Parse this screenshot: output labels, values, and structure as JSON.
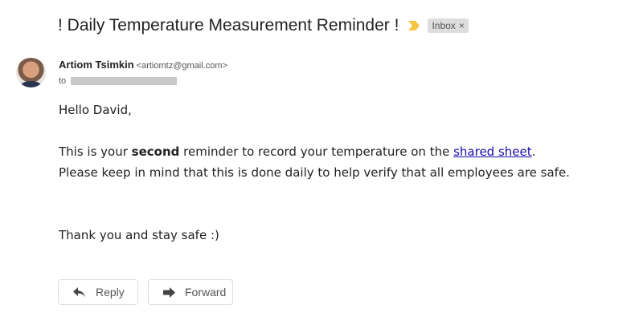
{
  "subject": "! Daily Temperature Measurement Reminder !",
  "label": {
    "text": "Inbox",
    "close": "×"
  },
  "sender": {
    "name": "Artiom Tsimkin",
    "email": "<artiomtz@gmail.com>"
  },
  "to_label": "to",
  "body": {
    "greeting": "Hello David,",
    "line1_a": "This is your ",
    "line1_bold": "second",
    "line1_b": " reminder to record your temperature on the ",
    "link": "shared sheet",
    "line1_c": ".",
    "line2": "Please keep in mind that this is done daily to help verify that all employees are safe.",
    "closing": "Thank you and stay safe :)"
  },
  "actions": {
    "reply": "Reply",
    "forward": "Forward"
  },
  "colors": {
    "importance": "#f4c542",
    "link": "#1a0dab"
  }
}
